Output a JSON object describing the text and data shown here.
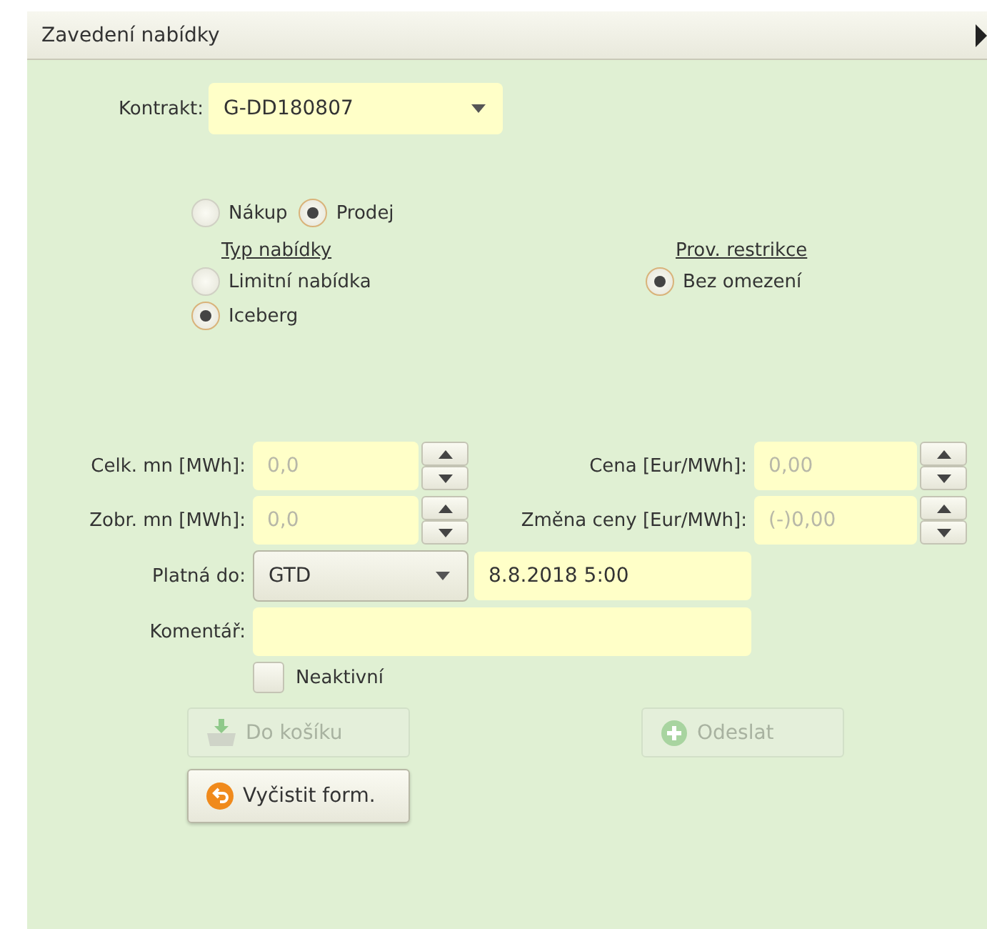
{
  "panel": {
    "title": "Zavedení nabídky",
    "collapsed": false
  },
  "contract": {
    "label": "Kontrakt:",
    "value": "G-DD180807"
  },
  "side": [
    {
      "label": "Nákup",
      "selected": false
    },
    {
      "label": "Prodej",
      "selected": true
    }
  ],
  "order_type": {
    "heading": "Typ nabídky",
    "options": [
      {
        "label": "Limitní nabídka",
        "selected": false
      },
      {
        "label": "Iceberg",
        "selected": true
      }
    ]
  },
  "restriction": {
    "heading": "Prov. restrikce",
    "options": [
      {
        "label": "Bez omezení",
        "selected": true
      }
    ]
  },
  "numeric_rows": [
    {
      "left": {
        "label": "Celk. mn [MWh]:",
        "placeholder": "0,0"
      },
      "right": {
        "label": "Cena [Eur/MWh]:",
        "placeholder": "0,00"
      }
    },
    {
      "left": {
        "label": "Zobr. mn [MWh]:",
        "placeholder": "0,0"
      },
      "right": {
        "label": "Změna ceny [Eur/MWh]:",
        "placeholder": "(-)0,00"
      }
    }
  ],
  "valid_until": {
    "label": "Platná do:",
    "mode": "GTD",
    "date": "8.8.2018 5:00"
  },
  "comment": {
    "label": "Komentář:"
  },
  "inactive": {
    "label": "Neaktivní",
    "checked": false
  },
  "buttons": [
    {
      "label": "Do košíku",
      "kind": "basket",
      "disabled": true
    },
    {
      "label": "Odeslat",
      "kind": "add",
      "disabled": true
    },
    {
      "label": "Vyčistit form.",
      "kind": "undo",
      "disabled": false
    }
  ]
}
